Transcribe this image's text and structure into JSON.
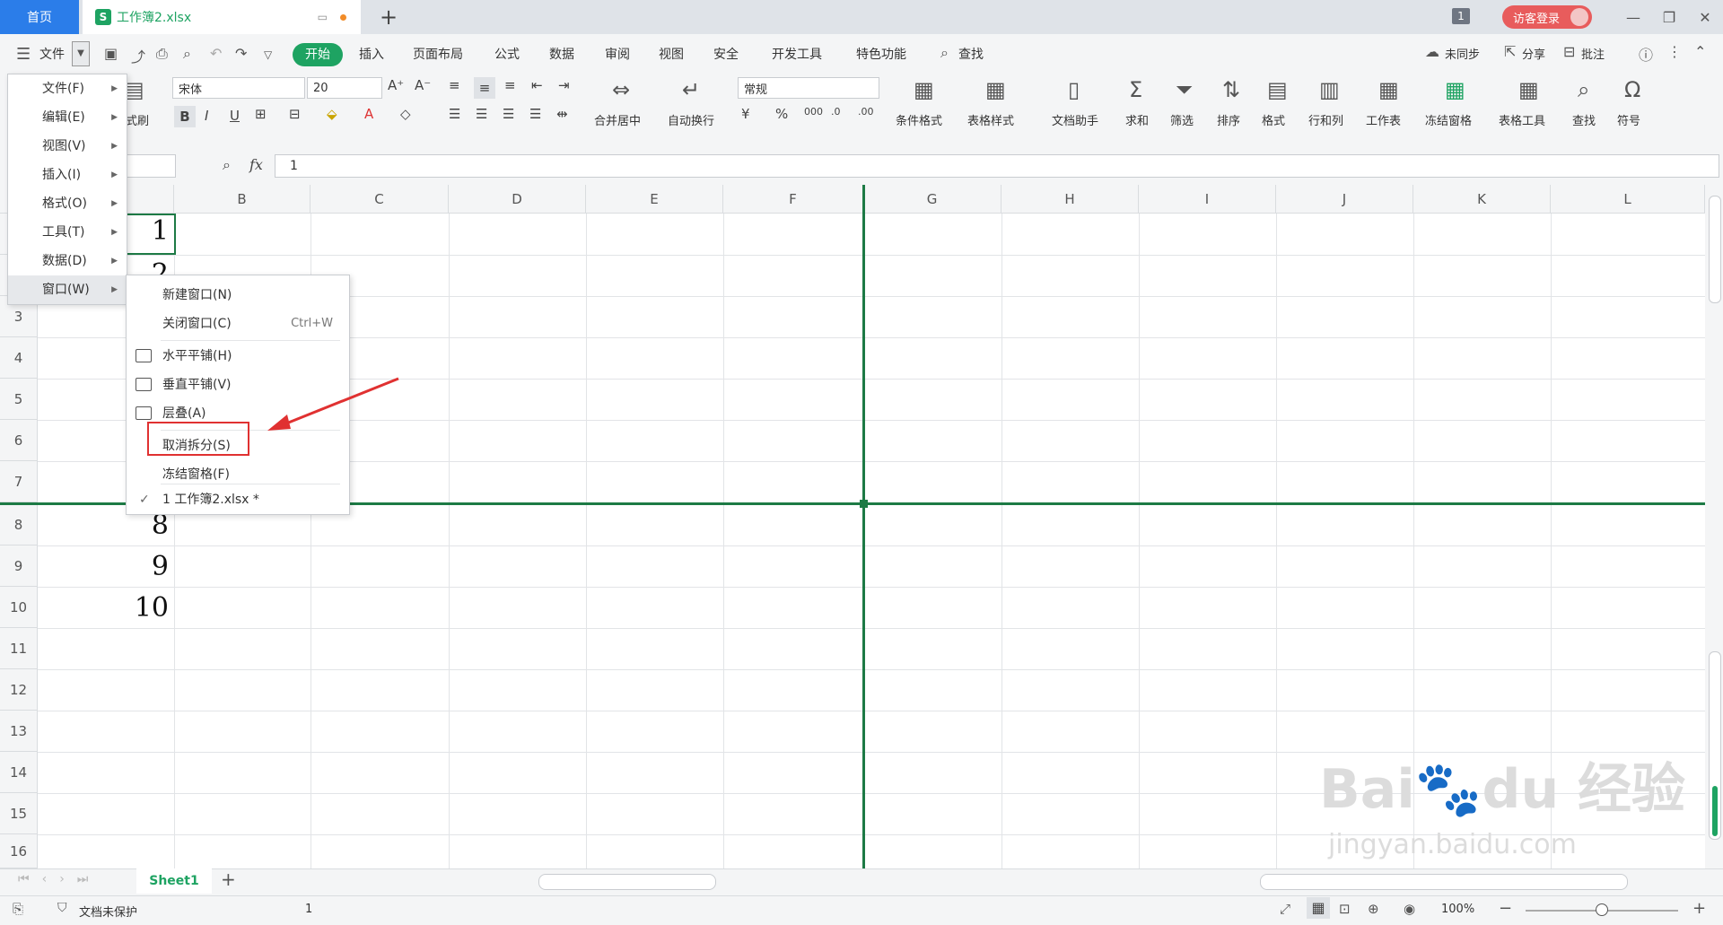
{
  "titlebar": {
    "home_tab": "首页",
    "file_tab": "工作簿2.xlsx",
    "file_icon": "S",
    "window_count": "1",
    "login": "访客登录"
  },
  "menubar": {
    "file": "文件",
    "tabs": [
      "开始",
      "插入",
      "页面布局",
      "公式",
      "数据",
      "审阅",
      "视图",
      "安全",
      "开发工具",
      "特色功能"
    ],
    "search": "查找",
    "sync": "未同步",
    "share": "分享",
    "comment": "批注"
  },
  "ribbon": {
    "format_brush": "式刷",
    "font_name": "宋体",
    "font_size": "20",
    "number_format": "常规",
    "merge_center": "合并居中",
    "wrap_text": "自动换行",
    "conditional_format": "条件格式",
    "table_style": "表格样式",
    "doc_helper": "文档助手",
    "sum": "求和",
    "filter": "筛选",
    "sort": "排序",
    "format": "格式",
    "rows_cols": "行和列",
    "worksheet": "工作表",
    "freeze": "冻结窗格",
    "table_tools": "表格工具",
    "find": "查找",
    "symbol": "符号"
  },
  "formula": {
    "fx": "fx",
    "value": "1"
  },
  "grid": {
    "columns": [
      "B",
      "C",
      "D",
      "E",
      "F",
      "G",
      "H",
      "I",
      "J",
      "K",
      "L"
    ],
    "rows_top": [
      "3",
      "4",
      "5",
      "6",
      "7"
    ],
    "rows_bottom": [
      "8",
      "9",
      "10",
      "11",
      "12",
      "13",
      "14",
      "15",
      "16"
    ],
    "values": {
      "r1": "1",
      "r2": "2",
      "r8": "8",
      "r9": "9",
      "r10": "10"
    }
  },
  "file_menu": {
    "items": [
      "文件(F)",
      "编辑(E)",
      "视图(V)",
      "插入(I)",
      "格式(O)",
      "工具(T)",
      "数据(D)",
      "窗口(W)"
    ]
  },
  "window_menu": {
    "new_window": "新建窗口(N)",
    "close_window": "关闭窗口(C)",
    "close_shortcut": "Ctrl+W",
    "tile_horizontal": "水平平铺(H)",
    "tile_vertical": "垂直平铺(V)",
    "cascade": "层叠(A)",
    "unsplit": "取消拆分(S)",
    "freeze_panes": "冻结窗格(F)",
    "open_doc": "1 工作簿2.xlsx *"
  },
  "sheetbar": {
    "sheet": "Sheet1"
  },
  "statusbar": {
    "protect": "文档未保护",
    "value": "1",
    "zoom": "100%"
  },
  "colors": {
    "accent_green": "#1ea362",
    "split_line": "#1d7a45",
    "home_blue": "#2b7de9",
    "highlight_red": "#e03131"
  }
}
